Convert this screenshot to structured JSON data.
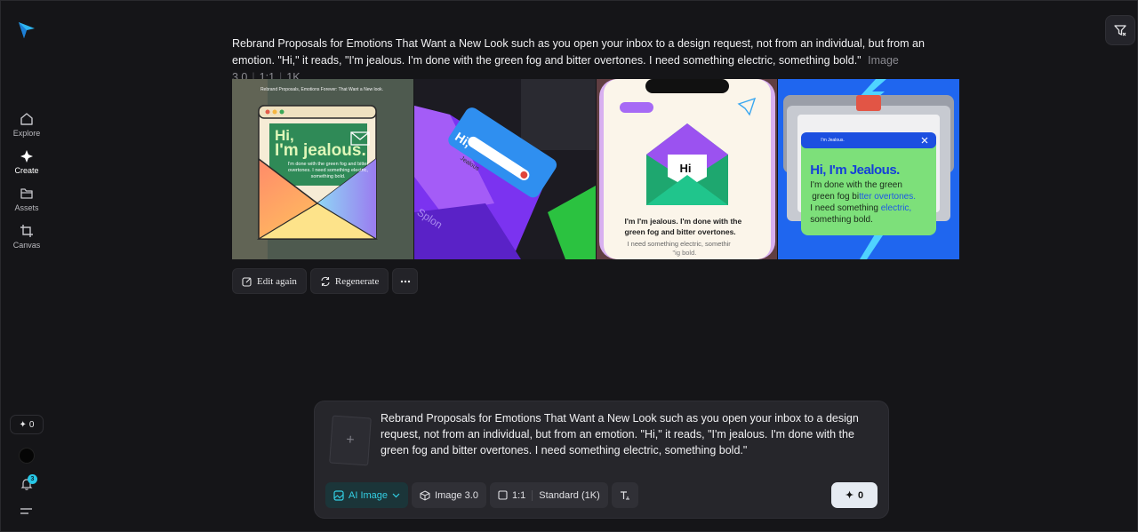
{
  "sidebar": {
    "items": [
      {
        "label": "Explore",
        "icon": "home-icon"
      },
      {
        "label": "Create",
        "icon": "sparkle-icon"
      },
      {
        "label": "Assets",
        "icon": "folder-icon"
      },
      {
        "label": "Canvas",
        "icon": "crop-icon"
      }
    ],
    "credits": "0",
    "notifications": "3"
  },
  "result": {
    "prompt": "Rebrand Proposals for Emotions That Want a New Look such as you open your inbox to a design request, not from an individual, but from an emotion. \"Hi,\" it reads, \"I'm jealous. I'm done with the green fog and bitter overtones. I need something electric, something bold.\"",
    "model": "Image 3.0",
    "ratio": "1:1",
    "resolution": "1K",
    "images": [
      {
        "heading": "Rebrand Proposals, Emotions Forever: That Want a New look.",
        "hi": "Hi,",
        "big": "I'm jealous.",
        "small": "I'm done with the green fog and bitter overtones. I need something electric, something bold."
      },
      {
        "card_title": "Hi,",
        "card_label": "Jealous",
        "tag": "Splon"
      },
      {
        "hi": "Hi",
        "line1": "I'm  I'm jealous.  I'm done with the",
        "line2": "green fog and bitter overtones.",
        "line3": "I need something electric, somethir",
        "line4": "\"ig bold."
      },
      {
        "window_title": "I'm Jealous.",
        "headline": "Hi, I'm Jealous.",
        "body1": "I'm done with the green",
        "body2a": "green fog bi",
        "body2b": "tter overtones.",
        "body3a": "I need something ",
        "body3b": "electric,",
        "body4": "something bold."
      }
    ],
    "actions": {
      "edit": "Edit again",
      "regenerate": "Regenerate"
    }
  },
  "composer": {
    "prompt": "Rebrand Proposals for Emotions That Want a New Look such as you open your inbox to a design request, not from an individual, but from an emotion. \"Hi,\" it reads, \"I'm jealous. I'm done with the green fog and bitter overtones. I need something electric, something bold.\"",
    "mode": "AI Image",
    "model": "Image 3.0",
    "ratio": "1:1",
    "quality": "Standard (1K)",
    "generate_cost": "0"
  },
  "colors": {
    "accent": "#33cfe4",
    "background": "#151518"
  }
}
